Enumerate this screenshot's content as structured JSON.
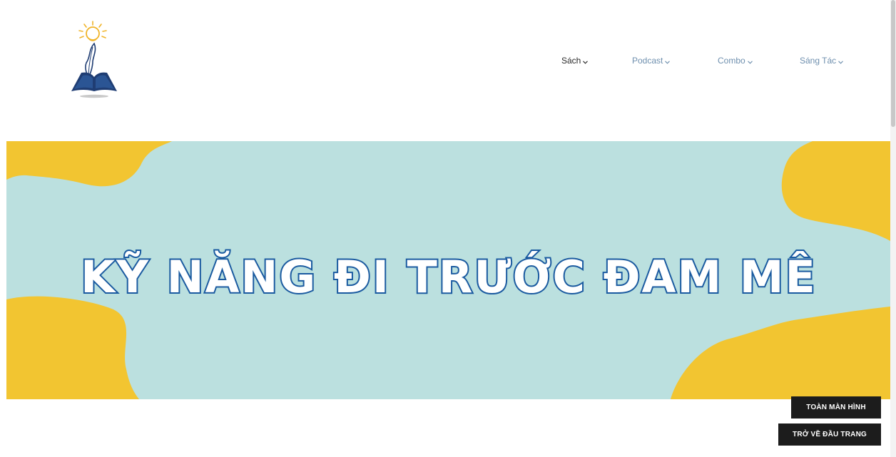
{
  "header": {
    "logo_icon": "book-quill-lightbulb-logo",
    "nav": [
      {
        "label": "Sách",
        "state": "active"
      },
      {
        "label": "Podcast",
        "state": "inactive"
      },
      {
        "label": "Combo",
        "state": "inactive"
      },
      {
        "label": "Sáng Tác",
        "state": "inactive"
      }
    ]
  },
  "banner": {
    "title": "KỸ NĂNG ĐI TRƯỚC ĐAM MÊ",
    "background_color": "#bbe0df",
    "blob_color": "#f2c531",
    "text_fill": "#ffffff",
    "text_stroke": "#1a5aa0"
  },
  "buttons": {
    "fullscreen_label": "TOÀN MÀN HÌNH",
    "back_to_top_label": "TRỞ VỀ ĐẦU TRANG"
  },
  "colors": {
    "nav_active": "#2a2a2a",
    "nav_inactive": "#6e8fae",
    "button_bg": "#1c1c1c"
  }
}
